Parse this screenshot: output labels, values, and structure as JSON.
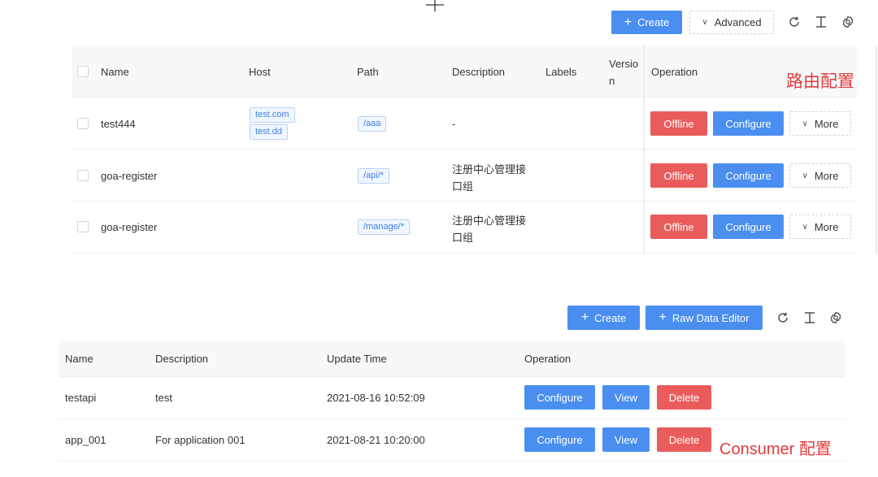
{
  "routes_toolbar": {
    "create_label": "Create",
    "advanced_label": "Advanced"
  },
  "routes_table": {
    "columns": {
      "name": "Name",
      "host": "Host",
      "path": "Path",
      "description": "Description",
      "labels": "Labels",
      "version_line1": "Versio",
      "version_line2": "n",
      "operation": "Operation"
    },
    "rows": [
      {
        "name": "test444",
        "hosts": [
          "test.com",
          "test.dd"
        ],
        "path": "/aaa",
        "description": "-",
        "offline_label": "Offline",
        "configure_label": "Configure",
        "more_label": "More"
      },
      {
        "name": "goa-register",
        "hosts": [],
        "path": "/api/*",
        "description_line1": "注册中心管理接",
        "description_line2": "口组",
        "offline_label": "Offline",
        "configure_label": "Configure",
        "more_label": "More"
      },
      {
        "name": "goa-register",
        "hosts": [],
        "path": "/manage/*",
        "description_line1": "注册中心管理接",
        "description_line2": "口组",
        "offline_label": "Offline",
        "configure_label": "Configure",
        "more_label": "More"
      }
    ]
  },
  "routes_annotation": "路由配置",
  "consumers_toolbar": {
    "create_label": "Create",
    "raw_editor_label": "Raw Data Editor"
  },
  "consumers_table": {
    "columns": {
      "name": "Name",
      "description": "Description",
      "update_time": "Update Time",
      "operation": "Operation"
    },
    "rows": [
      {
        "name": "testapi",
        "description": "test",
        "update_time": "2021-08-16 10:52:09",
        "configure_label": "Configure",
        "view_label": "View",
        "delete_label": "Delete"
      },
      {
        "name": "app_001",
        "description": "For application 001",
        "update_time": "2021-08-21 10:20:00",
        "configure_label": "Configure",
        "view_label": "View",
        "delete_label": "Delete"
      }
    ]
  },
  "consumers_annotation": "Consumer 配置",
  "colors": {
    "primary": "#4a8ff0",
    "danger": "#ea5c5c",
    "annotation": "#e23d3d",
    "header_bg": "#f7f8fa"
  },
  "icons": [
    "plus-icon",
    "chevron-down-icon",
    "reload-icon",
    "column-height-icon",
    "setting-icon",
    "crosshair-cursor-icon"
  ]
}
